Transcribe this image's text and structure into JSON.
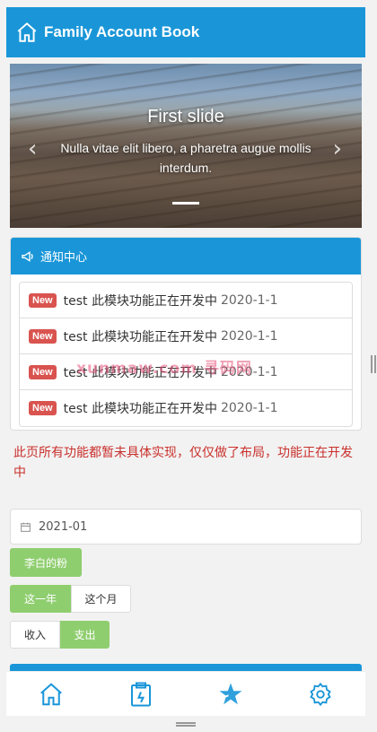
{
  "header": {
    "title": "Family Account Book",
    "home_icon": "home-icon"
  },
  "carousel": {
    "slide_title": "First slide",
    "slide_text": "Nulla vitae elit libero, a pharetra augue mollis interdum.",
    "prev_glyph": "‹",
    "next_glyph": "›"
  },
  "notice": {
    "title": "通知中心",
    "items": [
      {
        "badge": "New",
        "text": "test 此模块功能正在开发中",
        "date": "2020-1-1"
      },
      {
        "badge": "New",
        "text": "test 此模块功能正在开发中",
        "date": "2020-1-1"
      },
      {
        "badge": "New",
        "text": "test 此模块功能正在开发中",
        "date": "2020-1-1"
      },
      {
        "badge": "New",
        "text": "test 此模块功能正在开发中",
        "date": "2020-1-1"
      }
    ]
  },
  "watermark": "xunmaw.com 寻码网",
  "warning": "此页所有功能都暂未具体实现，仅仅做了布局，功能正在开发中",
  "date_picker": {
    "value": "2021-01"
  },
  "user_button": "李白的粉",
  "period": {
    "year": "这一年",
    "month": "这个月"
  },
  "type": {
    "income": "收入",
    "expense": "支出"
  },
  "tabbar": [
    "home-icon",
    "clipboard-icon",
    "star-icon",
    "settings-icon"
  ],
  "colors": {
    "primary": "#1a96d8",
    "green": "#8fce6f",
    "danger": "#d9534f"
  }
}
